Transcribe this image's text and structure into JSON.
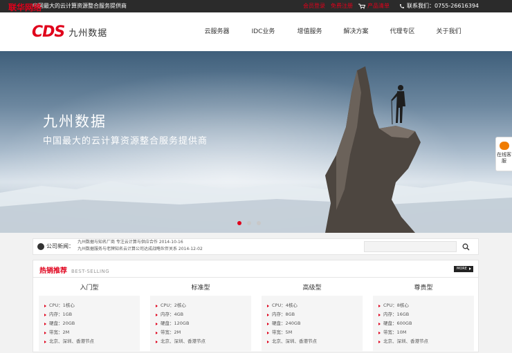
{
  "topbar": {
    "watermark": "联华网络",
    "slogan": "中国最大的云计算资源整合服务提供商",
    "login": "会员登录",
    "register": "免费注册",
    "cart": "产品清单",
    "hotline": "联系我们：0755-26616394"
  },
  "logo": {
    "mark": "CDS",
    "name": "九州数据"
  },
  "nav": [
    "云服务器",
    "IDC业务",
    "增值服务",
    "解决方案",
    "代理专区",
    "关于我们"
  ],
  "banner": {
    "title": "九州数据",
    "subtitle": "中国最大的云计算资源整合服务提供商",
    "slides": 3,
    "active_slide": 1
  },
  "sidechat": {
    "label": "在线客服"
  },
  "news": {
    "label": "公司新闻：",
    "items": [
      "九州数据与知名厂商 专注云计算与供应合作 2014-10-16",
      "九州数据服务与老牌知名云计算公司达成战略伙伴关系 2014-12-02"
    ],
    "search_placeholder": ""
  },
  "hot": {
    "title": "热销推荐",
    "subtitle": "BEST-SELLING",
    "more": "MORE",
    "plans": [
      {
        "name": "入门型",
        "specs": [
          "CPU：1核心",
          "内存：1GB",
          "硬盘：20GB",
          "带宽：2M",
          "北京、深圳、香港节点"
        ]
      },
      {
        "name": "标准型",
        "specs": [
          "CPU：2核心",
          "内存：4GB",
          "硬盘：120GB",
          "带宽：2M",
          "北京、深圳、香港节点"
        ]
      },
      {
        "name": "高级型",
        "specs": [
          "CPU：4核心",
          "内存：8GB",
          "硬盘：240GB",
          "带宽：5M",
          "北京、深圳、香港节点"
        ]
      },
      {
        "name": "尊贵型",
        "specs": [
          "CPU：8核心",
          "内存：16GB",
          "硬盘：600GB",
          "带宽：10M",
          "北京、深圳、香港节点"
        ]
      }
    ]
  },
  "colors": {
    "brand_red": "#e0001b",
    "topbar_bg": "#2b2b2b",
    "accent_orange": "#f07c00"
  }
}
